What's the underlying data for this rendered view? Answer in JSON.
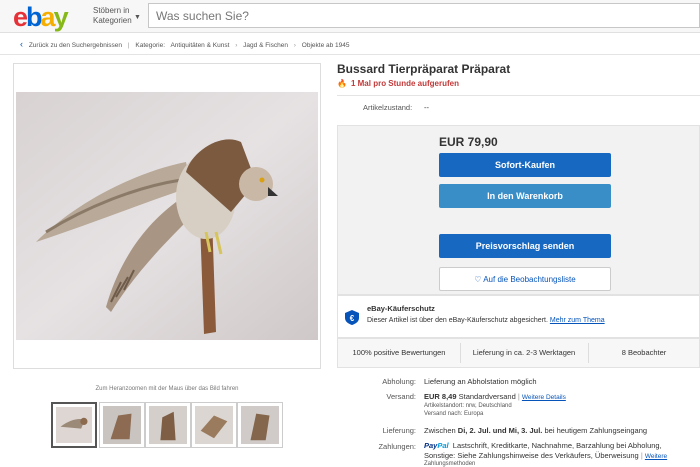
{
  "header": {
    "logo": "ebay",
    "browse_line1": "Stöbern in",
    "browse_line2": "Kategorien",
    "search_placeholder": "Was suchen Sie?"
  },
  "breadcrumb": {
    "back": "Zurück zu den Suchergebnissen",
    "category_label": "Kategorie:",
    "items": [
      "Antiquitäten & Kunst",
      "Jagd & Fischen",
      "Objekte ab 1945"
    ]
  },
  "gallery": {
    "zoom_hint": "Zum Heranzoomen mit der Maus über das Bild fahren",
    "thumb_count": 5
  },
  "listing": {
    "title": "Bussard Tierpräparat Präparat",
    "views": "1 Mal pro Stunde aufgerufen",
    "condition_label": "Artikelzustand:",
    "condition_value": "--",
    "price": "EUR 79,90",
    "buy_now": "Sofort-Kaufen",
    "add_to_cart": "In den Warenkorb",
    "make_offer": "Preisvorschlag senden",
    "watch": "Auf die Beobachtungsliste"
  },
  "protection": {
    "title": "eBay-Käuferschutz",
    "text": "Dieser Artikel ist über den eBay-Käuferschutz abgesichert.",
    "link": "Mehr zum Thema"
  },
  "stats": {
    "feedback": "100% positive Bewertungen",
    "delivery": "Lieferung in ca. 2-3 Werktagen",
    "watchers": "8 Beobachter"
  },
  "details": {
    "pickup_label": "Abholung:",
    "pickup_value": "Lieferung an Abholstation möglich",
    "shipping_label": "Versand:",
    "shipping_price": "EUR 8,49",
    "shipping_type": "Standardversand",
    "shipping_more": "Weitere Details",
    "item_location": "Artikelstandort: nrw, Deutschland",
    "ships_to": "Versand nach: Europa",
    "delivery_label": "Lieferung:",
    "delivery_pre": "Zwischen",
    "delivery_dates": "Di, 2. Jul. und Mi, 3. Jul.",
    "delivery_post": "bei heutigem Zahlungseingang",
    "payment_label": "Zahlungen:",
    "paypal_1": "Pay",
    "paypal_2": "Pal",
    "payment_line1": "Lastschrift, Kreditkarte, Nachnahme, Barzahlung bei Abholung,",
    "payment_line2": "Sonstige: Siehe Zahlungshinweise des Verkäufers, Überweisung",
    "payment_more": "Weitere",
    "payment_line3": "Zahlungsmethoden"
  },
  "colors": {
    "primary_button": "#1768c0",
    "secondary_button": "#3a8ec8",
    "link": "#0654ba",
    "alert_red": "#c23939"
  }
}
